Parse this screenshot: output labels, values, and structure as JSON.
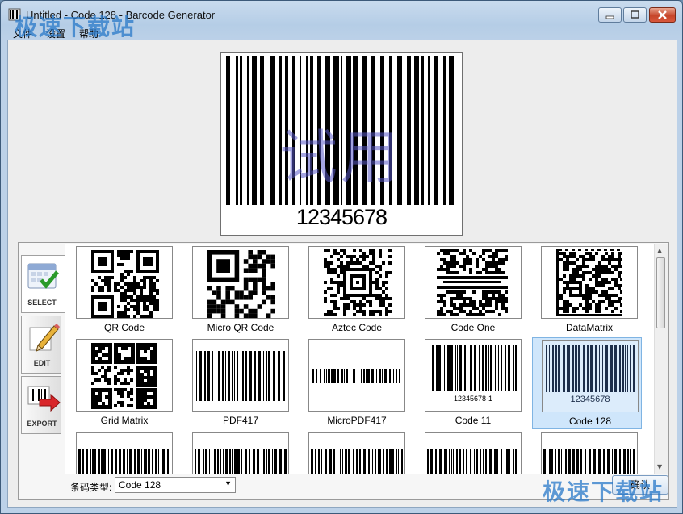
{
  "window": {
    "title": "Untitled - Code 128 - Barcode Generator"
  },
  "menu": [
    "文件",
    "设置",
    "帮助"
  ],
  "preview": {
    "human_readable": "12345678",
    "watermark": "试用"
  },
  "side_tabs": [
    {
      "label": "SELECT",
      "icon": "select-grid-icon"
    },
    {
      "label": "EDIT",
      "icon": "pencil-icon"
    },
    {
      "label": "EXPORT",
      "icon": "export-arrow-icon"
    }
  ],
  "gallery": [
    {
      "label": "QR Code",
      "kind": "qr"
    },
    {
      "label": "Micro QR Code",
      "kind": "microqr"
    },
    {
      "label": "Aztec Code",
      "kind": "aztec"
    },
    {
      "label": "Code One",
      "kind": "codeone"
    },
    {
      "label": "DataMatrix",
      "kind": "matrix"
    },
    {
      "label": "Grid Matrix",
      "kind": "grid"
    },
    {
      "label": "PDF417",
      "kind": "pdf417"
    },
    {
      "label": "MicroPDF417",
      "kind": "micropdf"
    },
    {
      "label": "Code 11",
      "kind": "linear",
      "text": "12345678-1"
    },
    {
      "label": "Code 128",
      "kind": "linear",
      "text": "12345678",
      "selected": true
    },
    {
      "label": "",
      "kind": "linear"
    },
    {
      "label": "",
      "kind": "linear"
    },
    {
      "label": "",
      "kind": "linear"
    },
    {
      "label": "",
      "kind": "linear"
    },
    {
      "label": "",
      "kind": "linear"
    }
  ],
  "type_bar": {
    "label": "条码类型:",
    "selected": "Code 128",
    "ok_label": "确认"
  },
  "watermarks": [
    "极速下载站",
    "极速下载站"
  ],
  "colors": {
    "selected_bg": "#cfe6fb",
    "watermark": "#2878c8",
    "trial": "#5a5ac8"
  }
}
